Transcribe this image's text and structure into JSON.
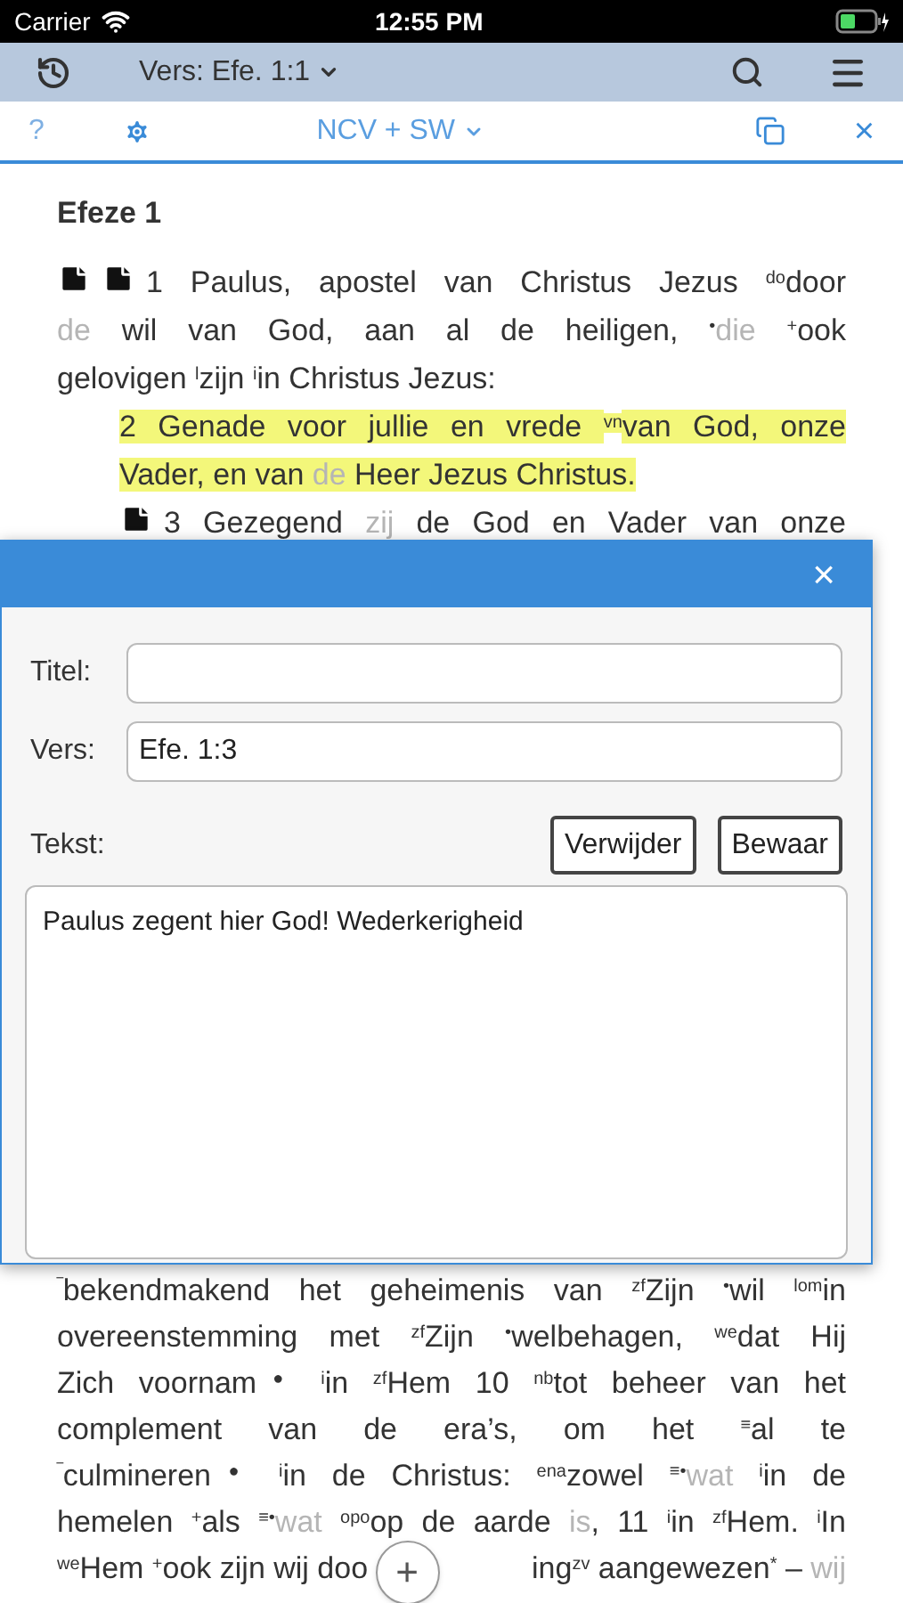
{
  "status_bar": {
    "carrier": "Carrier",
    "time": "12:55 PM"
  },
  "toolbar": {
    "verse_picker": "Vers: Efe. 1:1"
  },
  "subbar": {
    "help": "?",
    "translation": "NCV + SW",
    "close": "×"
  },
  "chapter_title": "Efeze 1",
  "paragraphs": [
    {
      "indented": false,
      "lines": [
        [
          {
            "kind": "note"
          },
          {
            "kind": "note"
          },
          {
            "kind": "text",
            "text": "1 Paulus, apostel van Christus Jezus "
          },
          {
            "kind": "sup",
            "text": "do"
          },
          {
            "kind": "text",
            "text": "door"
          }
        ],
        [
          {
            "kind": "faded",
            "text": "de"
          },
          {
            "kind": "text",
            "text": " wil van God, aan al de heiligen, "
          },
          {
            "kind": "sup",
            "text": "•"
          },
          {
            "kind": "faded",
            "text": "die "
          },
          {
            "kind": "sup",
            "text": "+"
          },
          {
            "kind": "text",
            "text": "ook"
          }
        ],
        [
          {
            "kind": "text",
            "text": "gelovigen "
          },
          {
            "kind": "sup",
            "text": "l"
          },
          {
            "kind": "text",
            "text": "zijn "
          },
          {
            "kind": "sup",
            "text": "i"
          },
          {
            "kind": "text",
            "text": "in Christus Jezus:"
          }
        ]
      ]
    },
    {
      "indented": true,
      "lines": [
        [
          {
            "kind": "hl",
            "text": "2 Genade voor jullie en vrede "
          },
          {
            "kind": "hl-sup",
            "text": "vn"
          },
          {
            "kind": "hl",
            "text": "van God, onze"
          }
        ],
        [
          {
            "kind": "hl",
            "text": "Vader, en van "
          },
          {
            "kind": "hl-faded",
            "text": "de"
          },
          {
            "kind": "hl",
            "text": " Heer Jezus Christus."
          }
        ]
      ]
    },
    {
      "indented": true,
      "lines": [
        [
          {
            "kind": "note"
          },
          {
            "kind": "text",
            "text": "3 Gezegend "
          },
          {
            "kind": "faded",
            "text": "zij"
          },
          {
            "kind": "text",
            "text": " de God en Vader van onze"
          }
        ]
      ]
    }
  ],
  "dialog": {
    "close": "×",
    "title_label": "Titel:",
    "verse_label": "Vers:",
    "verse_value": "Efe. 1:3",
    "text_label": "Tekst:",
    "delete_button": "Verwijder",
    "save_button": "Bewaar",
    "text_value": "Paulus zegent hier God! Wederkerigheid"
  },
  "continuation": {
    "lines": [
      [
        {
          "kind": "sup",
          "text": "‾"
        },
        {
          "kind": "text",
          "text": "bekendmakend het geheimenis van "
        },
        {
          "kind": "sup",
          "text": "zf"
        },
        {
          "kind": "text",
          "text": "Zijn "
        },
        {
          "kind": "sup",
          "text": "•"
        },
        {
          "kind": "text",
          "text": "wil "
        },
        {
          "kind": "sup",
          "text": "lom"
        },
        {
          "kind": "text",
          "text": "in"
        }
      ],
      [
        {
          "kind": "text",
          "text": "overeenstemming met "
        },
        {
          "kind": "sup",
          "text": "zf"
        },
        {
          "kind": "text",
          "text": "Zijn "
        },
        {
          "kind": "sup",
          "text": "•"
        },
        {
          "kind": "text",
          "text": "welbehagen, "
        },
        {
          "kind": "sup",
          "text": "we"
        },
        {
          "kind": "text",
          "text": "dat Hij"
        }
      ],
      [
        {
          "kind": "text",
          "text": "Zich voornam"
        },
        {
          "kind": "sup",
          "text": "● "
        },
        {
          "kind": "sup",
          "text": "i"
        },
        {
          "kind": "text",
          "text": "in "
        },
        {
          "kind": "sup",
          "text": "zf"
        },
        {
          "kind": "text",
          "text": "Hem 10 "
        },
        {
          "kind": "sup",
          "text": "nb"
        },
        {
          "kind": "text",
          "text": "tot beheer van het"
        }
      ],
      [
        {
          "kind": "text",
          "text": "complement van de era’s, om het "
        },
        {
          "kind": "sup",
          "text": "≡"
        },
        {
          "kind": "text",
          "text": "al te"
        }
      ],
      [
        {
          "kind": "sup",
          "text": "‾"
        },
        {
          "kind": "text",
          "text": "culmineren"
        },
        {
          "kind": "sup",
          "text": "● "
        },
        {
          "kind": "sup",
          "text": "i"
        },
        {
          "kind": "text",
          "text": "in de Christus: "
        },
        {
          "kind": "sup",
          "text": "ena"
        },
        {
          "kind": "text",
          "text": "zowel "
        },
        {
          "kind": "sup",
          "text": "≡•"
        },
        {
          "kind": "faded",
          "text": "wat "
        },
        {
          "kind": "sup",
          "text": "i"
        },
        {
          "kind": "text",
          "text": "in de"
        }
      ],
      [
        {
          "kind": "text",
          "text": "hemelen "
        },
        {
          "kind": "sup",
          "text": "+"
        },
        {
          "kind": "text",
          "text": "als "
        },
        {
          "kind": "sup",
          "text": "≡•"
        },
        {
          "kind": "faded",
          "text": "wat "
        },
        {
          "kind": "sup",
          "text": "opo"
        },
        {
          "kind": "text",
          "text": "op de aarde "
        },
        {
          "kind": "faded",
          "text": "is"
        },
        {
          "kind": "text",
          "text": ", 11 "
        },
        {
          "kind": "sup",
          "text": "i"
        },
        {
          "kind": "text",
          "text": "in "
        },
        {
          "kind": "sup",
          "text": "zf"
        },
        {
          "kind": "text",
          "text": "Hem. "
        },
        {
          "kind": "sup",
          "text": "i"
        },
        {
          "kind": "text",
          "text": "In"
        }
      ]
    ],
    "last_line": {
      "before": [
        {
          "kind": "sup",
          "text": "we"
        },
        {
          "kind": "text",
          "text": "Hem "
        },
        {
          "kind": "sup",
          "text": "+"
        },
        {
          "kind": "text",
          "text": "ook zijn wij doo"
        }
      ],
      "after": [
        {
          "kind": "text",
          "text": "ing"
        },
        {
          "kind": "sup",
          "text": "zv"
        },
        {
          "kind": "text",
          "text": " aangewezen"
        },
        {
          "kind": "sup",
          "text": "*"
        },
        {
          "kind": "text",
          "text": " – "
        },
        {
          "kind": "faded",
          "text": "wij"
        }
      ]
    }
  },
  "fab": {
    "label": "+"
  }
}
